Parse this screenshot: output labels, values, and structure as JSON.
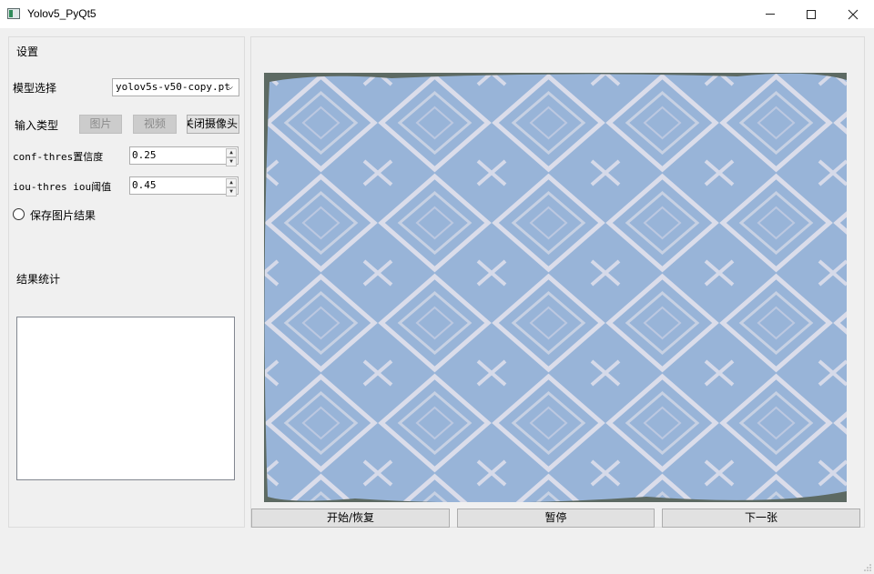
{
  "window": {
    "title": "Yolov5_PyQt5"
  },
  "settings": {
    "group_title": "设置",
    "model_label": "模型选择",
    "model_value": "yolov5s-v50-copy.pt",
    "input_type_label": "输入类型",
    "input_buttons": [
      "图片",
      "视频",
      "关闭摄像头"
    ],
    "conf_label": "conf-thres置信度",
    "conf_value": "0.25",
    "iou_label": "iou-thres iou阈值",
    "iou_value": "0.45",
    "save_label": "保存图片结果"
  },
  "results": {
    "title": "结果统计",
    "content": ""
  },
  "controls": {
    "start": "开始/恢复",
    "pause": "暂停",
    "next": "下一张"
  },
  "colors": {
    "image_fill": "#98b4d8",
    "image_pattern": "#e6e4ee",
    "image_border": "#5d6a63"
  }
}
